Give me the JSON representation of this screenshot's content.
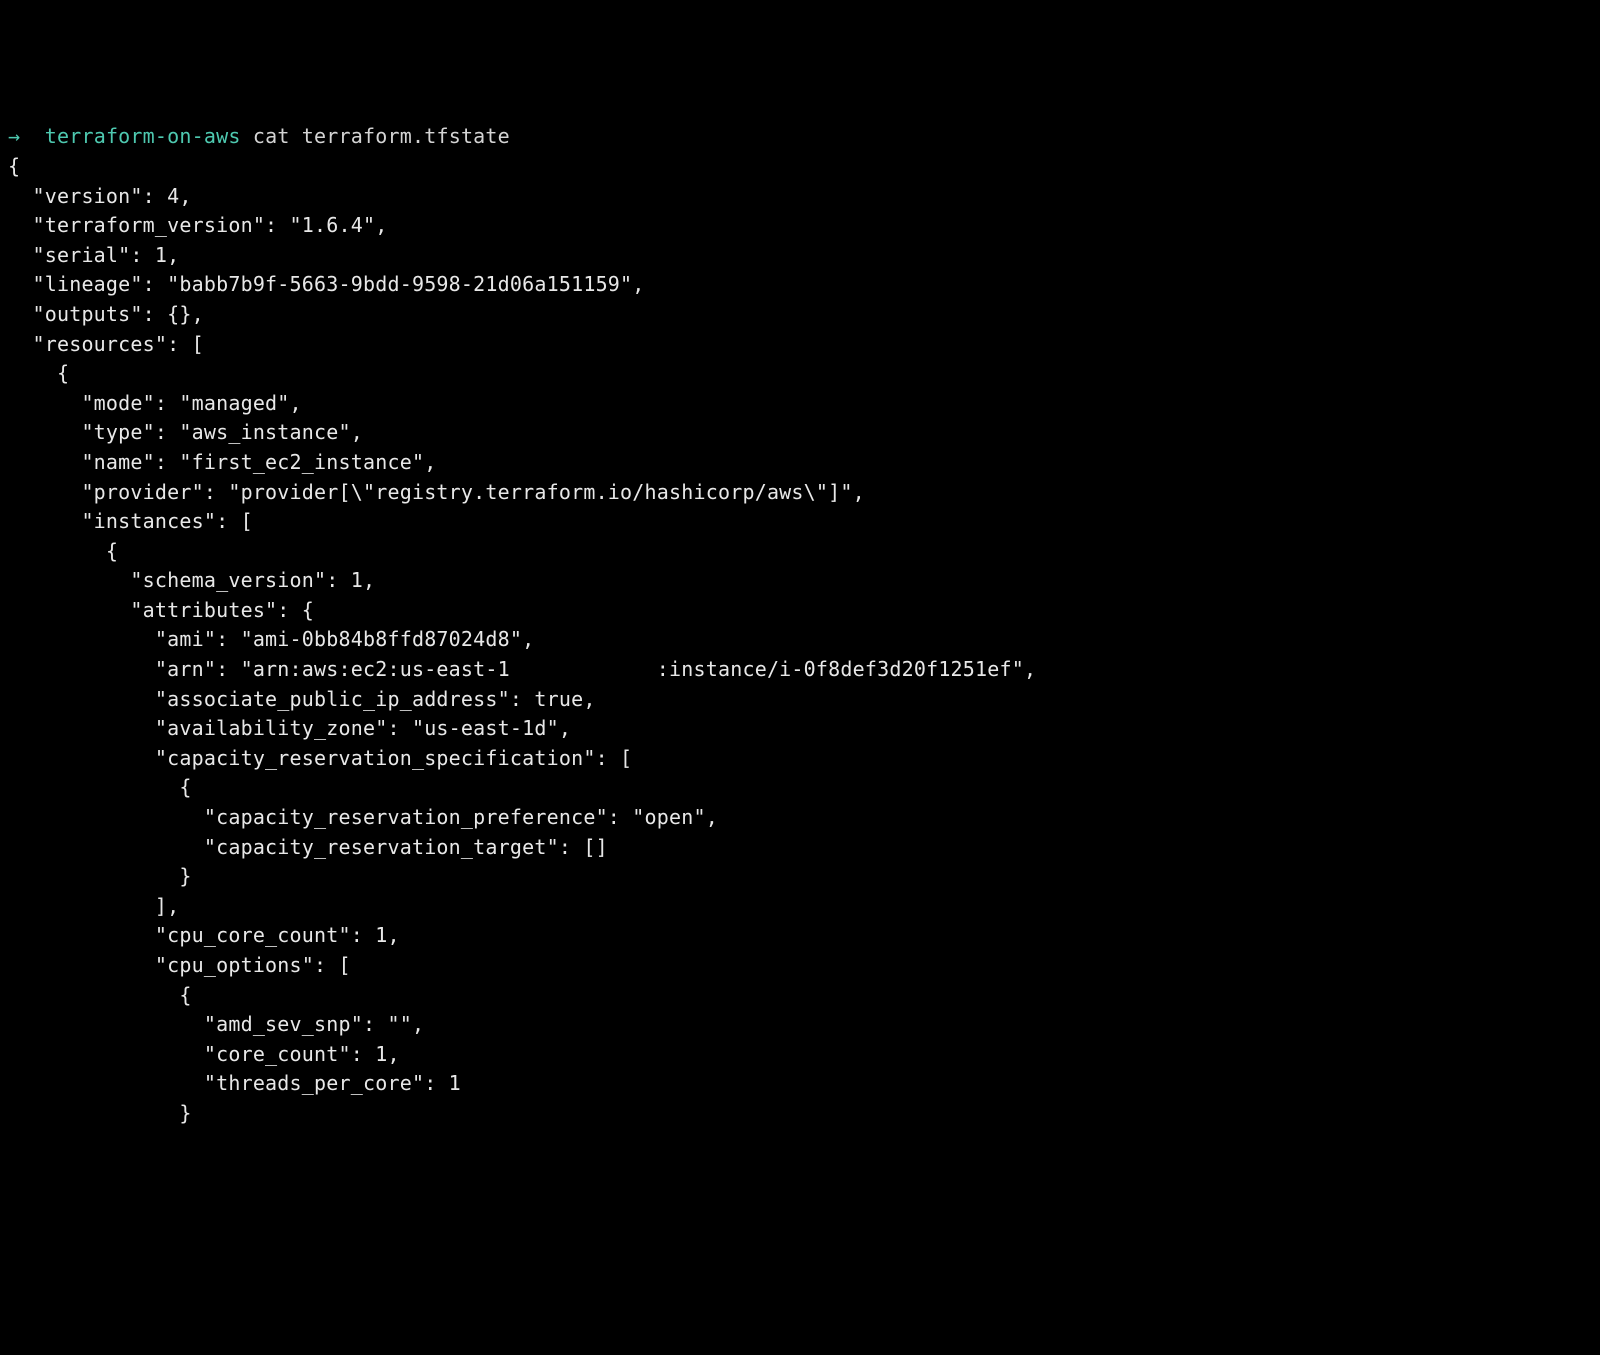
{
  "prompt": {
    "arrow": "→",
    "dir": "terraform-on-aws",
    "cmd": "cat terraform.tfstate"
  },
  "tfstate": {
    "l00": "{",
    "l01": "  \"version\": 4,",
    "l02": "  \"terraform_version\": \"1.6.4\",",
    "l03": "  \"serial\": 1,",
    "l04": "  \"lineage\": \"babb7b9f-5663-9bdd-9598-21d06a151159\",",
    "l05": "  \"outputs\": {},",
    "l06": "  \"resources\": [",
    "l07": "    {",
    "l08": "      \"mode\": \"managed\",",
    "l09": "      \"type\": \"aws_instance\",",
    "l10": "      \"name\": \"first_ec2_instance\",",
    "l11": "      \"provider\": \"provider[\\\"registry.terraform.io/hashicorp/aws\\\"]\",",
    "l12": "      \"instances\": [",
    "l13": "        {",
    "l14": "          \"schema_version\": 1,",
    "l15": "          \"attributes\": {",
    "l16": "            \"ami\": \"ami-0bb84b8ffd87024d8\",",
    "l17": "            \"arn\": \"arn:aws:ec2:us-east-1            :instance/i-0f8def3d20f1251ef\",",
    "l18": "            \"associate_public_ip_address\": true,",
    "l19": "            \"availability_zone\": \"us-east-1d\",",
    "l20": "            \"capacity_reservation_specification\": [",
    "l21": "              {",
    "l22": "                \"capacity_reservation_preference\": \"open\",",
    "l23": "                \"capacity_reservation_target\": []",
    "l24": "              }",
    "l25": "            ],",
    "l26": "            \"cpu_core_count\": 1,",
    "l27": "            \"cpu_options\": [",
    "l28": "              {",
    "l29": "                \"amd_sev_snp\": \"\",",
    "l30": "                \"core_count\": 1,",
    "l31": "                \"threads_per_core\": 1",
    "l32": "              }"
  }
}
